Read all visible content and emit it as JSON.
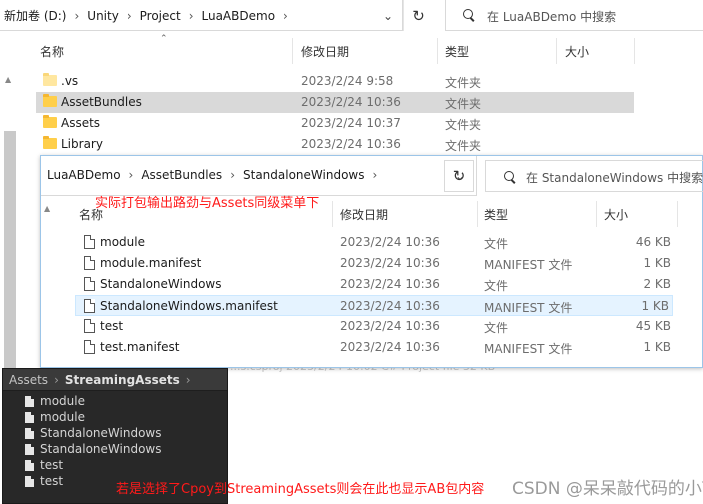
{
  "window1": {
    "breadcrumb": [
      "新加卷 (D:)",
      "Unity",
      "Project",
      "LuaABDemo"
    ],
    "search_placeholder": "在 LuaABDemo 中搜索",
    "columns": {
      "name": "名称",
      "date": "修改日期",
      "type": "类型",
      "size": "大小"
    },
    "rows": [
      {
        "name": ".vs",
        "date": "2023/2/24 9:58",
        "type": "文件夹",
        "size": ""
      },
      {
        "name": "AssetBundles",
        "date": "2023/2/24 10:36",
        "type": "文件夹",
        "size": ""
      },
      {
        "name": "Assets",
        "date": "2023/2/24 10:37",
        "type": "文件夹",
        "size": ""
      },
      {
        "name": "Library",
        "date": "2023/2/24 10:36",
        "type": "文件夹",
        "size": ""
      }
    ],
    "ghost_row": "...s.csproj    2023/2/24 10:02    C# Project file    32 KB"
  },
  "window2": {
    "breadcrumb": [
      "LuaABDemo",
      "AssetBundles",
      "StandaloneWindows"
    ],
    "search_placeholder": "在 StandaloneWindows 中搜索",
    "annotation": "实际打包输出路劲与Assets同级菜单下",
    "columns": {
      "name": "名称",
      "date": "修改日期",
      "type": "类型",
      "size": "大小"
    },
    "rows": [
      {
        "name": "module",
        "date": "2023/2/24 10:36",
        "type": "文件",
        "size": "46 KB"
      },
      {
        "name": "module.manifest",
        "date": "2023/2/24 10:36",
        "type": "MANIFEST 文件",
        "size": "1 KB"
      },
      {
        "name": "StandaloneWindows",
        "date": "2023/2/24 10:36",
        "type": "文件",
        "size": "2 KB"
      },
      {
        "name": "StandaloneWindows.manifest",
        "date": "2023/2/24 10:36",
        "type": "MANIFEST 文件",
        "size": "1 KB"
      },
      {
        "name": "test",
        "date": "2023/2/24 10:36",
        "type": "文件",
        "size": "45 KB"
      },
      {
        "name": "test.manifest",
        "date": "2023/2/24 10:36",
        "type": "MANIFEST 文件",
        "size": "1 KB"
      }
    ]
  },
  "unity": {
    "breadcrumb": [
      "Assets",
      "StreamingAssets"
    ],
    "items": [
      "module",
      "module",
      "StandaloneWindows",
      "StandaloneWindows",
      "test",
      "test"
    ]
  },
  "bottom_annotation": "若是选择了Cpoy到StreamingAssets则会在此也显示AB包内容",
  "watermark": "CSDN @呆呆敲代码的小Y",
  "colors": {
    "annotation": "#ff1a1a",
    "selected_row": "#d9d9d9",
    "hover_row": "#e5f3ff",
    "unity_bg": "#282828",
    "folder": "#ffcf4a"
  }
}
